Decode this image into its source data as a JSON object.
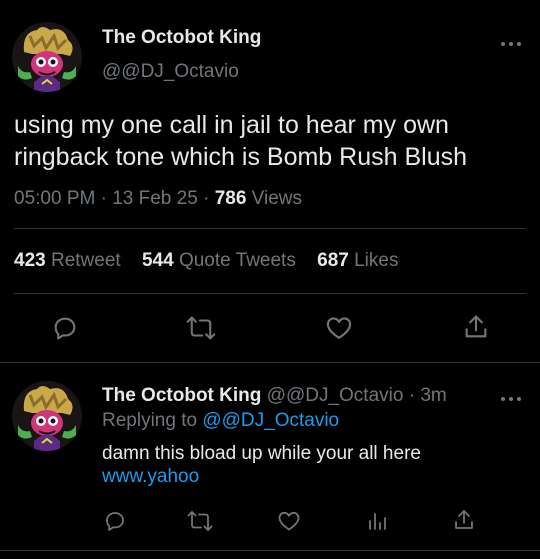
{
  "colors": {
    "background": "#000000",
    "text_primary": "#e7e9ea",
    "text_secondary": "#71767b",
    "link": "#1d9bf0",
    "divider": "#2f3336"
  },
  "main_tweet": {
    "display_name": "The Octobot King",
    "handle": "@@DJ_Octavio",
    "text": "using my one call in jail to hear my own ringback tone which is Bomb Rush Blush",
    "time": "05:00 PM",
    "separator": "·",
    "date": "13 Feb 25",
    "views_count": "786",
    "views_label": "Views",
    "stats": {
      "retweets_count": "423",
      "retweets_label": "Retweet",
      "quotes_count": "544",
      "quotes_label": "Quote Tweets",
      "likes_count": "687",
      "likes_label": "Likes"
    },
    "actions": [
      "reply-icon",
      "retweet-icon",
      "heart-icon",
      "share-icon"
    ]
  },
  "reply_tweet": {
    "display_name": "The Octobot King",
    "handle": "@@DJ_Octavio",
    "separator": "·",
    "time_ago": "3m",
    "replying_label": "Replying to",
    "replying_handle": "@@DJ_Octavio",
    "text": "damn this bload up while your all here",
    "link_text": "www.yahoo",
    "actions": [
      "reply-icon",
      "retweet-icon",
      "heart-icon",
      "analytics-icon",
      "share-icon"
    ]
  }
}
